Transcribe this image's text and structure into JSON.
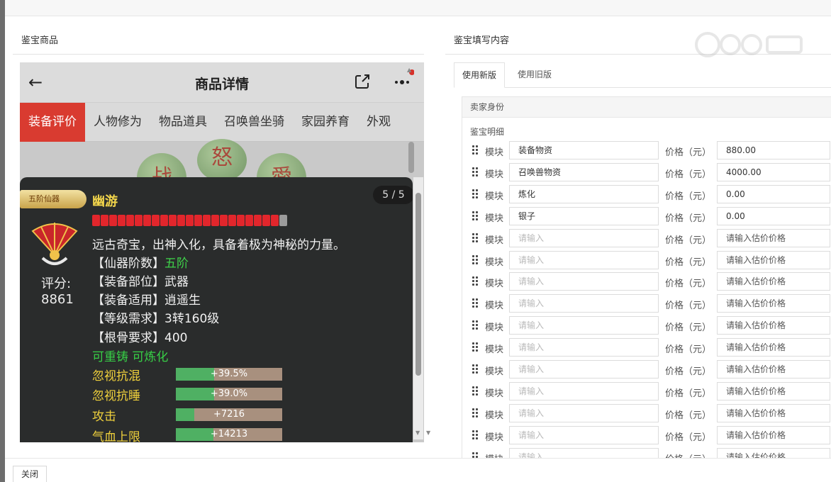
{
  "sections": {
    "left_title": "鉴宝商品",
    "right_title": "鉴宝填写内容"
  },
  "phone": {
    "title": "商品详情",
    "tabs": [
      {
        "label": "装备评价",
        "active": true
      },
      {
        "label": "人物修为"
      },
      {
        "label": "物品道具"
      },
      {
        "label": "召唤兽坐骑"
      },
      {
        "label": "家园养育"
      },
      {
        "label": "外观"
      }
    ],
    "bubbles": [
      "怒",
      "战",
      "愛"
    ]
  },
  "item": {
    "badge": "五阶仙器",
    "name": "幽游",
    "page": "5 / 5",
    "bars_red": 22,
    "bars_gray": 1,
    "score_label": "评分:",
    "score": "8861",
    "description": "远古奇宝，出神入化，具备着极为神秘的力量。",
    "attrs": [
      {
        "key": "【仙器阶数】",
        "value": "五阶",
        "highlight": true
      },
      {
        "key": "【装备部位】",
        "value": "武器"
      },
      {
        "key": "【装备适用】",
        "value": "逍遥生"
      },
      {
        "key": "【等级需求】",
        "value": "3转160级"
      },
      {
        "key": "【根骨要求】",
        "value": "400"
      }
    ],
    "reforge": "可重铸 可炼化",
    "stats": [
      {
        "label": "忽视抗混",
        "value": "+39.5%",
        "fill": 0.36
      },
      {
        "label": "忽视抗睡",
        "value": "+39.0%",
        "fill": 0.36
      },
      {
        "label": "攻击",
        "value": "+7216",
        "fill": 0.17
      },
      {
        "label": "气血上限",
        "value": "+14213",
        "fill": 0.35
      }
    ]
  },
  "form": {
    "tabs": [
      "使用新版",
      "使用旧版"
    ],
    "seller_section": "卖家身份",
    "detail_label": "鉴宝明细",
    "module_label": "模块",
    "price_label": "价格（元）",
    "name_placeholder": "请输入",
    "price_placeholder": "请输入估价价格",
    "rows": [
      {
        "name": "装备物资",
        "price": "880.00"
      },
      {
        "name": "召唤兽物资",
        "price": "4000.00"
      },
      {
        "name": "炼化",
        "price": "0.00"
      },
      {
        "name": "银子",
        "price": "0.00"
      },
      {
        "name": "",
        "price": ""
      },
      {
        "name": "",
        "price": ""
      },
      {
        "name": "",
        "price": ""
      },
      {
        "name": "",
        "price": ""
      },
      {
        "name": "",
        "price": ""
      },
      {
        "name": "",
        "price": ""
      },
      {
        "name": "",
        "price": ""
      },
      {
        "name": "",
        "price": ""
      },
      {
        "name": "",
        "price": ""
      },
      {
        "name": "",
        "price": ""
      },
      {
        "name": "",
        "price": ""
      }
    ]
  },
  "footer": {
    "close_label": "关闭"
  },
  "colors": {
    "accent_red": "#d93b30",
    "card_bg": "#2a2c2c",
    "stat_green": "#4fb063",
    "name_gold": "#f2d54b"
  }
}
